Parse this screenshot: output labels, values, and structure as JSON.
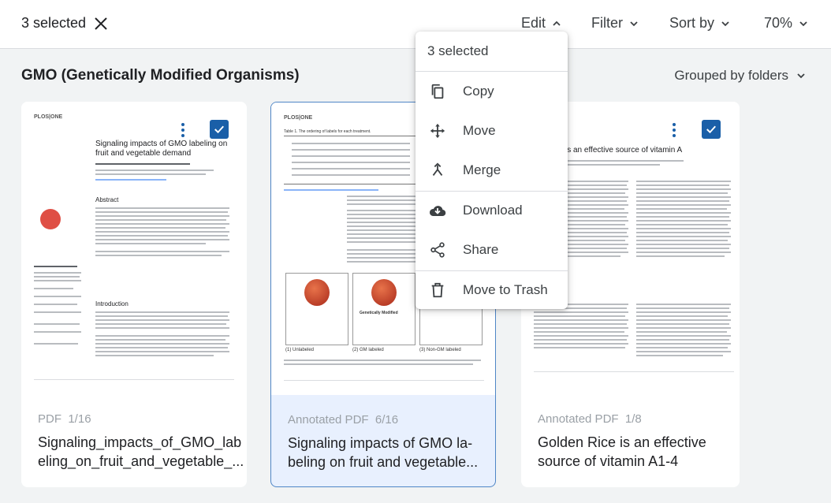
{
  "toolbar": {
    "selected_label": "3 selected",
    "edit_label": "Edit",
    "filter_label": "Filter",
    "sort_label": "Sort by",
    "zoom_label": "70%"
  },
  "group": {
    "title": "GMO (Genetically Modified Organisms)",
    "grouping_label": "Grouped by folders"
  },
  "cards": [
    {
      "type": "PDF",
      "pages": "1/16",
      "name": "Signaling_impacts_of_GMO_labeling_on_fruit_and_vegetable_...",
      "name_l1": "Signaling_impacts_of_GMO_lab",
      "name_l2": "eling_on_fruit_and_vegetable_...",
      "thumb_logo": "PLOS|ONE",
      "thumb_title": "Signaling impacts of GMO labeling on fruit and vegetable demand",
      "thumb_section": "Abstract",
      "thumb_intro": "Introduction"
    },
    {
      "type": "Annotated PDF",
      "pages": "6/16",
      "name_l1": "Signaling impacts of GMO la-",
      "name_l2": "beling on fruit and vegetable...",
      "thumb_logo": "PLOS|ONE",
      "thumb_table": "Table 1. The ordering of labels for each treatment.",
      "thumb_labels": [
        "(1) Unlabeled",
        "(2) GM labeled",
        "(3) Non-GM labeled"
      ],
      "thumb_mid": "Genetically Modified"
    },
    {
      "type": "Annotated PDF",
      "pages": "1/8",
      "name_l1": "Golden Rice is an effective",
      "name_l2": "source of vitamin A1-4",
      "thumb_title": "is an effective source of vitamin A"
    }
  ],
  "menu": {
    "header": "3 selected",
    "items": [
      {
        "label": "Copy",
        "icon": "copy-icon"
      },
      {
        "label": "Move",
        "icon": "move-icon"
      },
      {
        "label": "Merge",
        "icon": "merge-icon"
      },
      {
        "label": "Download",
        "icon": "cloud-download-icon"
      },
      {
        "label": "Share",
        "icon": "share-icon"
      },
      {
        "label": "Move to Trash",
        "icon": "trash-icon"
      }
    ]
  },
  "colors": {
    "accent": "#1a5fa8",
    "selected_card_bg": "#e8f0fe",
    "page_bg": "#f1f3f4"
  }
}
